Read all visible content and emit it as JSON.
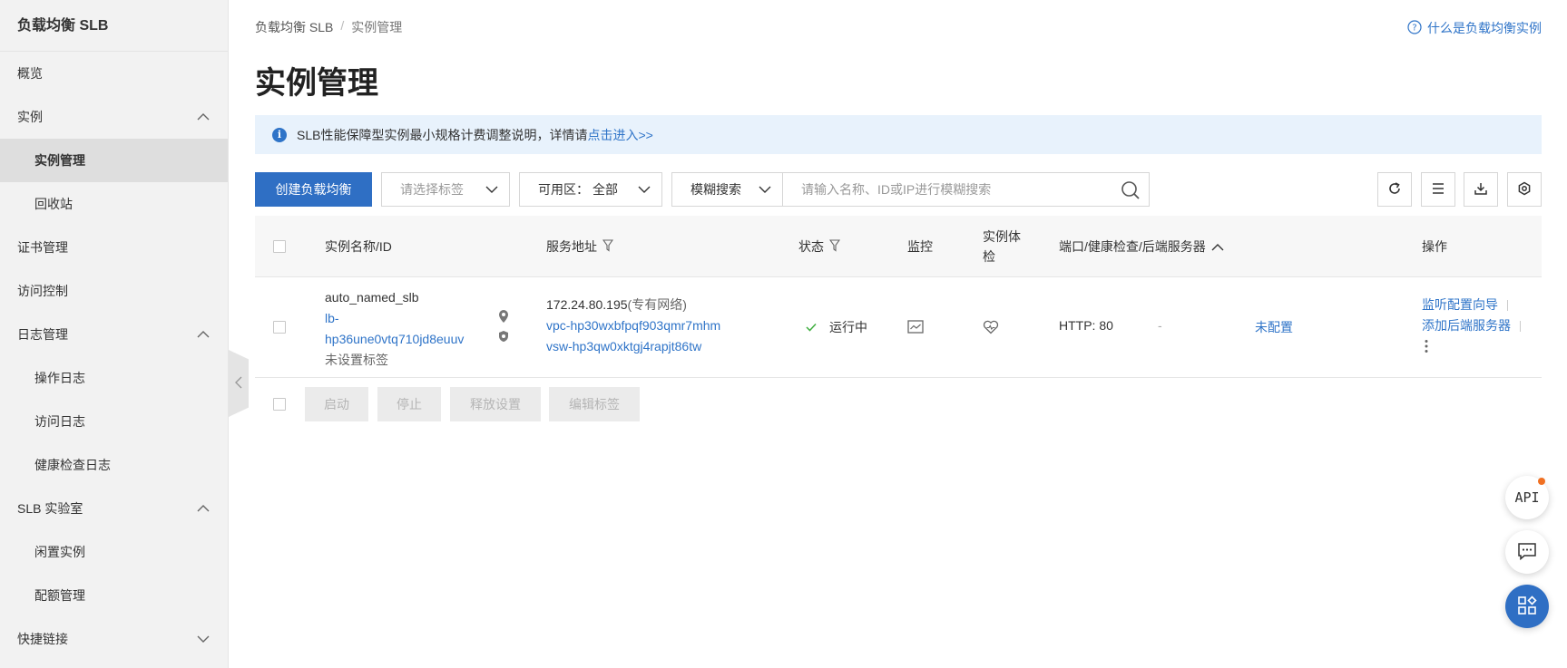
{
  "sidebar": {
    "title": "负载均衡 SLB",
    "items": [
      {
        "label": "概览"
      },
      {
        "label": "实例"
      },
      {
        "label": "实例管理"
      },
      {
        "label": "回收站"
      },
      {
        "label": "证书管理"
      },
      {
        "label": "访问控制"
      },
      {
        "label": "日志管理"
      },
      {
        "label": "操作日志"
      },
      {
        "label": "访问日志"
      },
      {
        "label": "健康检查日志"
      },
      {
        "label": "SLB 实验室"
      },
      {
        "label": "闲置实例"
      },
      {
        "label": "配额管理"
      },
      {
        "label": "快捷链接"
      }
    ]
  },
  "breadcrumb": {
    "root": "负载均衡 SLB",
    "sep": "/",
    "current": "实例管理"
  },
  "help": {
    "label": "什么是负载均衡实例"
  },
  "page": {
    "title": "实例管理"
  },
  "notice": {
    "text": "SLB性能保障型实例最小规格计费调整说明，详情请",
    "link": "点击进入>>"
  },
  "toolbar": {
    "create_label": "创建负载均衡",
    "tag_placeholder": "请选择标签",
    "zone_label": "可用区：",
    "zone_value": "全部",
    "search_mode": "模糊搜索",
    "search_placeholder": "请输入名称、ID或IP进行模糊搜索"
  },
  "table": {
    "headers": {
      "name": "实例名称/ID",
      "address": "服务地址",
      "status": "状态",
      "monitor": "监控",
      "health_line1": "实例体",
      "health_line2": "检",
      "ports": "端口/健康检查/后端服务器",
      "actions": "操作"
    },
    "rows": [
      {
        "name": "auto_named_slb",
        "id_line1": "lb-",
        "id_line2": "hp36une0vtq710jd8euuv",
        "tag": "未设置标签",
        "ip": "172.24.80.195",
        "network": "(专有网络)",
        "vpc": "vpc-hp30wxbfpqf903qmr7mhm",
        "vsw": "vsw-hp3qw0xktgj4rapjt86tw",
        "status": "运行中",
        "port": "HTTP:  80",
        "health": "-",
        "backend": "未配置",
        "action1": "监听配置向导",
        "action2": "添加后端服务器"
      }
    ]
  },
  "batch": {
    "start": "启动",
    "stop": "停止",
    "release": "释放设置",
    "edit_tags": "编辑标签"
  },
  "floating": {
    "api": "API"
  },
  "colors": {
    "primary": "#2f6fc4",
    "link": "#2f74c8",
    "success": "#3fae3f",
    "badge": "#f07022"
  }
}
